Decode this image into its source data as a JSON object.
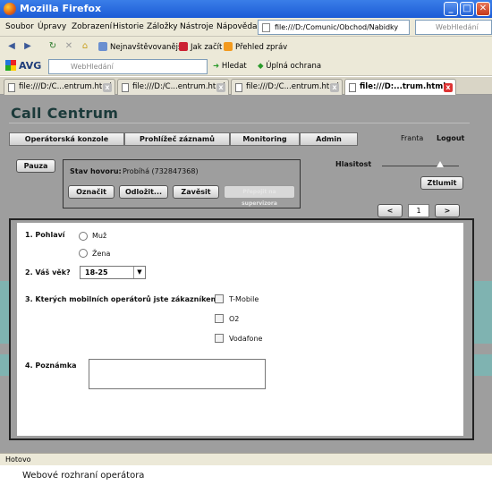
{
  "window": {
    "title": "Mozilla Firefox",
    "controls": {
      "minimize": "_",
      "maximize": "□",
      "close": "✕"
    }
  },
  "menu": [
    "Soubor",
    "Úpravy",
    "Zobrazení",
    "Historie",
    "Záložky",
    "Nástroje",
    "Nápověda"
  ],
  "address": {
    "url": "file:///D:/Comunic/Obchod/Nabidky",
    "search_placeholder": "WebHledání"
  },
  "bookmarks": [
    "Nejnavštěvovanější",
    "Jak začít",
    "Přehled zpráv"
  ],
  "avg": {
    "logo": "AVG",
    "search_placeholder": "WebHledání",
    "search_button": "Hledat",
    "protection": "Úplná ochrana"
  },
  "tabs": [
    {
      "label": "file:///D:/C...entrum.html",
      "active": false
    },
    {
      "label": "file:///D:/C...entrum.html",
      "active": false
    },
    {
      "label": "file:///D:/C...entrum.html",
      "active": false
    },
    {
      "label": "file:///D:...trum.html",
      "active": true
    }
  ],
  "app": {
    "title": "Call Centrum",
    "nav": [
      "Operátorská konzole",
      "Prohlížeč záznamů",
      "Monitoring",
      "Admin"
    ],
    "user": "Franta",
    "logout": "Logout",
    "pause_button": "Pauza",
    "call": {
      "status_label": "Stav hovoru:",
      "status_value": "Probíhá (732847368)",
      "buttons": [
        "Označit",
        "Odložit...",
        "Zavěsit",
        "Přepojit na supervizora"
      ]
    },
    "volume": {
      "label": "Hlasitost",
      "level": 0.75,
      "mute_button": "Ztlumit"
    },
    "pager": {
      "prev": "<",
      "next": ">",
      "page": "1"
    },
    "form": {
      "q1": {
        "label": "1. Pohlaví",
        "options": [
          "Muž",
          "Žena"
        ]
      },
      "q2": {
        "label": "2. Váš věk?",
        "value": "18-25",
        "arrow": "▼"
      },
      "q3": {
        "label": "3. Kterých mobilních operátorů jste zákazníkem?",
        "options": [
          "T-Mobile",
          "O2",
          "Vodafone"
        ]
      },
      "q4": {
        "label": "4. Poznámka",
        "value": ""
      }
    }
  },
  "status_bar": "Hotovo",
  "caption": "Webové rozhraní operátora"
}
